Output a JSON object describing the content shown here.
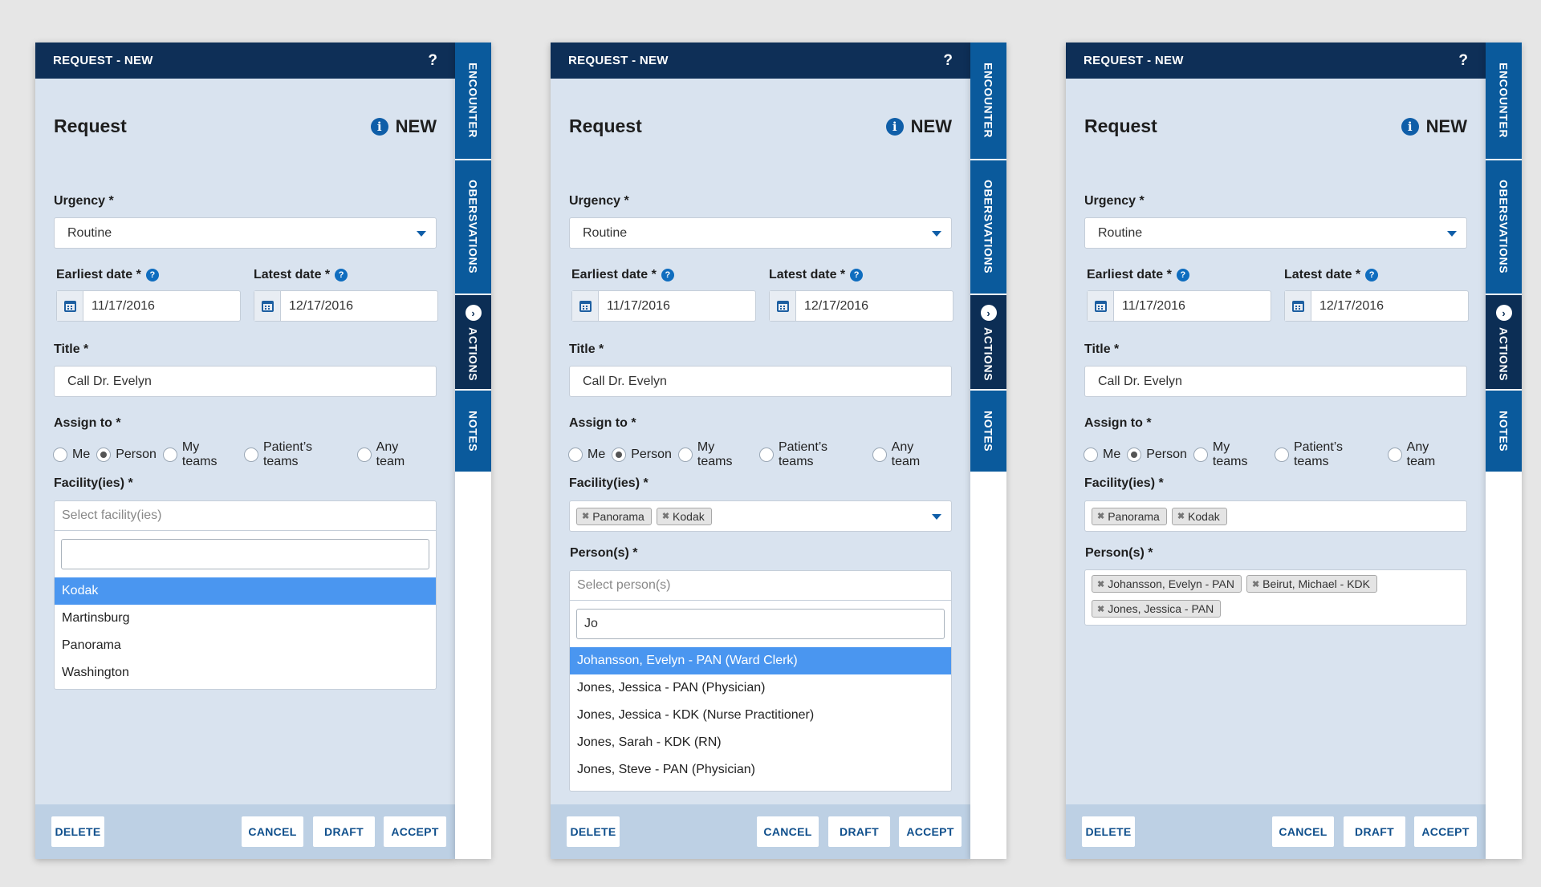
{
  "header": {
    "title": "REQUEST - NEW",
    "help": "?"
  },
  "form": {
    "heading": "Request",
    "status": "NEW",
    "urgency_label": "Urgency *",
    "urgency_value": "Routine",
    "earliest_label": "Earliest date *",
    "earliest_value": "11/17/2016",
    "latest_label": "Latest date *",
    "latest_value": "12/17/2016",
    "title_label": "Title *",
    "title_value": "Call Dr. Evelyn",
    "assign_label": "Assign to *",
    "assign_options": [
      "Me",
      "Person",
      "My teams",
      "Patient’s teams",
      "Any team"
    ],
    "assign_selected": "Person",
    "facility_label": "Facility(ies) *",
    "facility_placeholder": "Select facility(ies)",
    "persons_label": "Person(s) *",
    "persons_placeholder": "Select person(s)"
  },
  "panel1": {
    "facility_options": [
      "Kodak",
      "Martinsburg",
      "Panorama",
      "Washington"
    ],
    "facility_highlighted": "Kodak",
    "facility_search": ""
  },
  "panel2": {
    "facility_tags": [
      "Panorama",
      "Kodak"
    ],
    "person_search": "Jo",
    "person_options": [
      "Johansson, Evelyn - PAN (Ward Clerk)",
      "Jones, Jessica - PAN (Physician)",
      "Jones, Jessica - KDK (Nurse Practitioner)",
      "Jones, Sarah - KDK (RN)",
      "Jones, Steve - PAN (Physician)"
    ],
    "person_highlighted": "Johansson, Evelyn - PAN (Ward Clerk)"
  },
  "panel3": {
    "facility_tags": [
      "Panorama",
      "Kodak"
    ],
    "person_tags": [
      "Johansson, Evelyn - PAN",
      "Beirut, Michael - KDK",
      "Jones, Jessica - PAN"
    ]
  },
  "footer": {
    "delete": "DELETE",
    "cancel": "CANCEL",
    "draft": "DRAFT",
    "accept": "ACCEPT"
  },
  "tabs": {
    "encounter": "ENCOUNTER",
    "observations": "OBERSVATIONS",
    "actions": "ACTIONS",
    "notes": "NOTES"
  },
  "icons": {
    "info": "info-icon",
    "help": "question-icon",
    "calendar": "calendar-icon",
    "remove": "close-icon",
    "actions_tab": "chevron-right-icon"
  },
  "colors": {
    "header": "#0e2f57",
    "panel_bg": "#d9e3ef",
    "tab": "#0a5a9c",
    "tab_active": "#0c2e55",
    "highlight": "#4a96f0",
    "footer": "#bdd0e4"
  }
}
